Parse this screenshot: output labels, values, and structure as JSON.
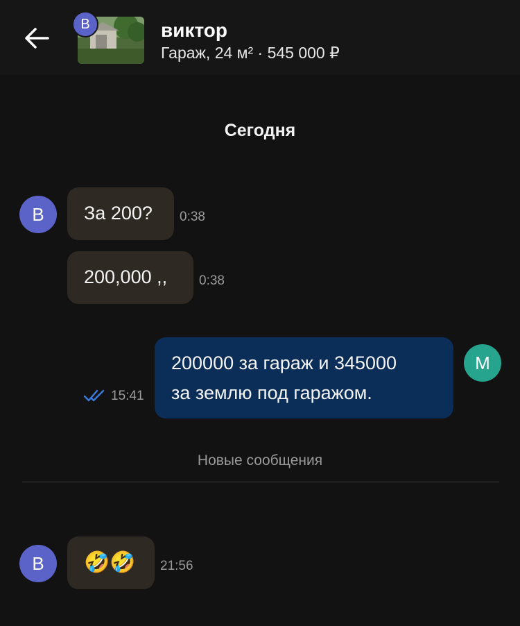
{
  "header": {
    "back_icon": "arrow-left-icon",
    "contact_initial": "В",
    "contact_name": "виктор",
    "listing": "Гараж, 24 м² · 545 000 ₽"
  },
  "chat": {
    "date_separator": "Сегодня",
    "new_messages_label": "Новые сообщения",
    "messages": [
      {
        "from": "В",
        "text": "За 200?",
        "time": "0:38"
      },
      {
        "from": "В",
        "text": "200,000 ,,",
        "time": "0:38"
      },
      {
        "from": "М",
        "lines": [
          "200000 за гараж и 345000",
          "за землю под гаражом."
        ],
        "time": "15:41",
        "status_icon": "double-check-icon"
      },
      {
        "from": "В",
        "text": "🤣🤣",
        "time": "21:56"
      }
    ]
  },
  "colors": {
    "background": "#121212",
    "incoming_bubble": "#2e2922",
    "outgoing_bubble": "#0a2e58",
    "avatar_v": "#5b63c9",
    "avatar_m": "#26a48e",
    "read_check": "#3d7be0"
  }
}
